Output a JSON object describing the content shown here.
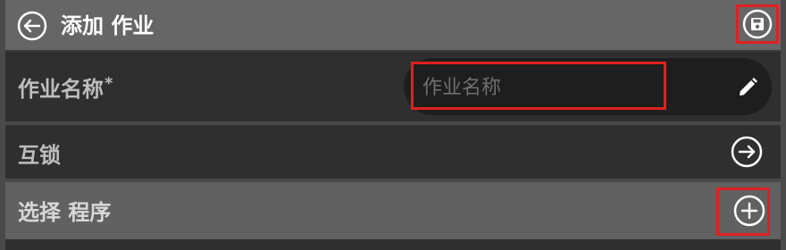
{
  "header": {
    "title": "添加 作业",
    "back_icon": "arrow-left-circle-icon",
    "save_icon": "save-disk-circle-icon"
  },
  "form": {
    "job_name": {
      "label": "作业名称",
      "required_marker": "*",
      "placeholder": "作业名称",
      "value": "",
      "edit_icon": "pencil-icon"
    },
    "interlock": {
      "label": "互锁",
      "icon": "arrow-right-circle-icon"
    },
    "program": {
      "label": "选择 程序",
      "icon": "plus-circle-icon"
    }
  },
  "colors": {
    "header_bg": "#666666",
    "row_bg": "#2f2f2f",
    "selected_row_bg": "#616161",
    "highlight": "#e02020",
    "input_bg": "#1e1e1e"
  }
}
